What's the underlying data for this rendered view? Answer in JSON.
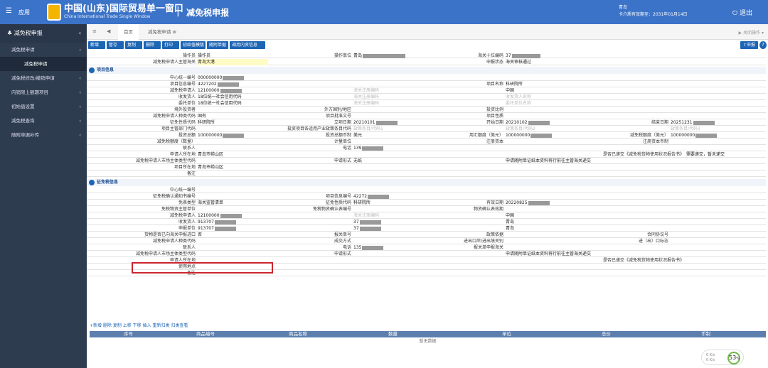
{
  "header": {
    "menu_label": "应用",
    "brand_cn": "中国(山东)国际贸易单一窗口",
    "brand_en": "China International Trade Single Window",
    "system_title": "减免税申报",
    "user_line1": "青岛",
    "user_line2": "卡介质有效期至：2031年01月14日",
    "logout": "退出"
  },
  "sidebar": {
    "title": "减免税申报",
    "items": [
      "减免税申请",
      "减免税申请",
      "减免税修改/撤销申请",
      "内销限上额期项目",
      "初始值设置",
      "减免税查询",
      "随附单据补传"
    ]
  },
  "tabs": {
    "home": "首页",
    "current": "减免税申请",
    "right": "关闭操作"
  },
  "toolbar": {
    "buttons": [
      "新增",
      "暂存",
      "复制",
      "删除",
      "打印",
      "初始值模版",
      "随附单据",
      "调用内资信息"
    ],
    "apply": "申报"
  },
  "top": {
    "operator": "操作员",
    "op_unit": "操作单位",
    "op_unit_val": "青岛",
    "customs_code": "海关十位编码",
    "customs_code_val": "37",
    "dept": "减免税申请人主管海关",
    "dept_val": "青岛大港",
    "status": "申报状态",
    "status_val": "海关审核通过"
  },
  "section1": {
    "title": "项目信息",
    "rows": [
      [
        [
          "中心统一编号",
          "000000000"
        ]
      ],
      [
        [
          "项目信息编号",
          "4227202"
        ],
        [
          "",
          "",
          ""
        ],
        [
          "项目名称",
          "科研院所"
        ]
      ],
      [
        [
          "减免税申请人",
          "12100000"
        ],
        [
          "",
          "海关注册编码"
        ],
        [
          "",
          "中国"
        ]
      ],
      [
        [
          "收发货人",
          "18位统一社会信用代码"
        ],
        [
          "",
          "海关注册编码"
        ],
        [
          "",
          "收发货人名称"
        ]
      ],
      [
        [
          "委托单位",
          "18位统一社会信用代码"
        ],
        [
          "",
          "海关注册编码"
        ],
        [
          "",
          "委托单位名称"
        ]
      ],
      [
        [
          "境外投资者",
          ""
        ],
        [
          "外方国别/地区",
          ""
        ],
        [
          "投资比例",
          ""
        ]
      ],
      [
        [
          "减免税申请人种类代码",
          "国有"
        ],
        [
          "项目批准文号",
          ""
        ],
        [
          "项目性质",
          ""
        ]
      ],
      [
        [
          "征免性质代码",
          "科研院所"
        ],
        [
          "立项日期",
          "20210101"
        ],
        [
          "开始日期",
          "20210102"
        ],
        [
          "结束日期",
          "20251231"
        ]
      ],
      [
        [
          "项目主管部门代码",
          ""
        ],
        [
          "投资项目各适用产业政策条目代码",
          "政策条目/代码1"
        ],
        [
          "",
          "政策条目/代码2"
        ],
        [
          "",
          "政策条目/代码3"
        ]
      ],
      [
        [
          "投资总额",
          "100000000"
        ],
        [
          "投资总额币制",
          "美元"
        ],
        [
          "用汇额度（美元）",
          "100000000"
        ],
        [
          "减免税额度（美元）",
          "100000000"
        ]
      ],
      [
        [
          "减免税额度（数量）",
          ""
        ],
        [
          "计量单位",
          ""
        ],
        [
          "注册资本",
          ""
        ],
        [
          "注册资本币制",
          ""
        ]
      ],
      [
        [
          "联系人",
          ""
        ],
        [
          "电话",
          "139"
        ]
      ],
      [
        [
          "申请人所在地",
          "青岛市崂山区"
        ],
        [
          "是否已递交《减免税货物使用状况报告书》",
          "需要递交，暂未递交"
        ]
      ],
      [
        [
          "减免税申请人市场主体类型代码",
          ""
        ],
        [
          "申请形式",
          "无纸"
        ],
        [
          "",
          "申请随附单证纸本资料将行前往主管海关递交"
        ]
      ],
      [
        [
          "项目所在地",
          "青岛市崂山区"
        ]
      ],
      [
        [
          "备注",
          ""
        ]
      ]
    ]
  },
  "section2": {
    "title": "征免税信息",
    "rows": [
      [
        [
          "中心统一编号",
          ""
        ]
      ],
      [
        [
          "征免税确认通知书编号",
          ""
        ],
        [
          "项目信息编号",
          "42272"
        ]
      ],
      [
        [
          "免表类型",
          "海关监管清单"
        ],
        [
          "征免性质代码",
          "科研院所"
        ],
        [
          "有效日期",
          "20220825"
        ]
      ],
      [
        [
          "免税物资主管单位",
          ""
        ],
        [
          "免税物资确认表编号",
          ""
        ],
        [
          "物资确认表效期",
          ""
        ]
      ],
      [
        [
          "减免税申请人",
          "12100000"
        ],
        [
          "",
          "海关注册编码"
        ],
        [
          "",
          "中国"
        ]
      ],
      [
        [
          "收发货人",
          "913707"
        ],
        [
          "",
          "37"
        ],
        [
          "",
          "青岛"
        ]
      ],
      [
        [
          "申报单位",
          "913707"
        ],
        [
          "",
          "37"
        ],
        [
          "",
          "青岛"
        ]
      ],
      [
        [
          "货物是否已向海关申报进口",
          "否"
        ],
        [
          "报关单号",
          ""
        ],
        [
          "政策依据",
          ""
        ],
        [
          "合同协议号",
          ""
        ]
      ],
      [
        [
          "减免税申请人种类代码",
          ""
        ],
        [
          "成交方式",
          ""
        ],
        [
          "进出口岸/进出境关别",
          ""
        ],
        [
          "进（出）口标志",
          ""
        ]
      ],
      [
        [
          "联系人",
          ""
        ],
        [
          "电话",
          "135"
        ],
        [
          "报关单申报海关",
          ""
        ]
      ],
      [
        [
          "减免税申请人市场主体类型代码",
          ""
        ],
        [
          "申请形式",
          ""
        ],
        [
          "",
          "申请随附单证纸本资料将行前往主管海关递交"
        ]
      ],
      [
        [
          "申请人所在地",
          ""
        ],
        [
          "是否已递交《减免税货物使用状况报告书》",
          ""
        ]
      ],
      [
        [
          "使用地点",
          ""
        ]
      ],
      [
        [
          "备注",
          ""
        ]
      ]
    ]
  },
  "detail": {
    "tools": "+新增 删除 复制 上移 下移 插入 重新归类 归类查看",
    "columns": [
      "序号",
      "商品编号",
      "商品名称",
      "数量",
      "单位",
      "总价",
      "币制"
    ],
    "empty": "暂无数据"
  },
  "zoom": {
    "up": "0 K/s",
    "down": "0 K/s",
    "pct": "53",
    "unit": "%"
  }
}
